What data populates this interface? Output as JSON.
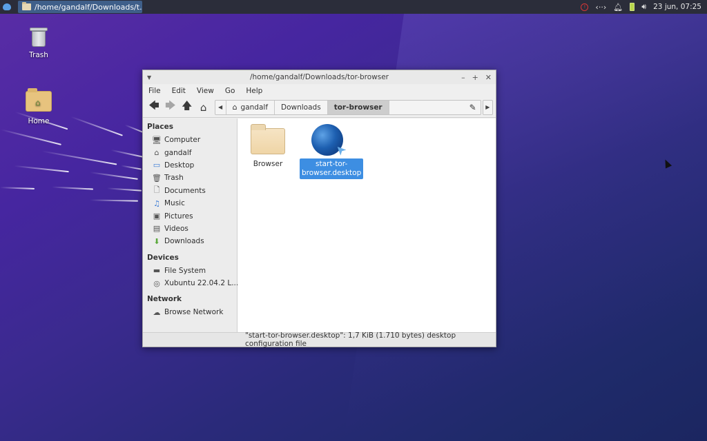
{
  "panel": {
    "task_title": "/home/gandalf/Downloads/t...",
    "clock": "23 jun, 07:25",
    "tray_network": "‹··›"
  },
  "desktop": {
    "icons": [
      {
        "label": "Trash",
        "icon": "trash-icon"
      },
      {
        "label": "Home",
        "icon": "home-folder-icon"
      }
    ]
  },
  "window": {
    "title": "/home/gandalf/Downloads/tor-browser",
    "menu": [
      "File",
      "Edit",
      "View",
      "Go",
      "Help"
    ],
    "breadcrumbs": [
      "gandalf",
      "Downloads",
      "tor-browser"
    ],
    "sidebar": {
      "places_heading": "Places",
      "places": [
        {
          "label": "Computer",
          "icon": "computer-icon"
        },
        {
          "label": "gandalf",
          "icon": "home-icon"
        },
        {
          "label": "Desktop",
          "icon": "desktop-icon"
        },
        {
          "label": "Trash",
          "icon": "trash-icon"
        },
        {
          "label": "Documents",
          "icon": "documents-icon"
        },
        {
          "label": "Music",
          "icon": "music-icon"
        },
        {
          "label": "Pictures",
          "icon": "pictures-icon"
        },
        {
          "label": "Videos",
          "icon": "videos-icon"
        },
        {
          "label": "Downloads",
          "icon": "downloads-icon"
        }
      ],
      "devices_heading": "Devices",
      "devices": [
        {
          "label": "File System",
          "icon": "drive-icon"
        },
        {
          "label": "Xubuntu 22.04.2 L...",
          "icon": "disc-icon"
        }
      ],
      "network_heading": "Network",
      "network": [
        {
          "label": "Browse Network",
          "icon": "network-icon"
        }
      ]
    },
    "files": [
      {
        "name": "Browser",
        "icon": "folder-icon",
        "selected": false
      },
      {
        "name": "start-tor-\nbrowser.desktop",
        "icon": "tor-globe-icon",
        "selected": true
      }
    ],
    "status": "\"start-tor-browser.desktop\": 1,7 KiB (1.710 bytes) desktop configuration file"
  }
}
